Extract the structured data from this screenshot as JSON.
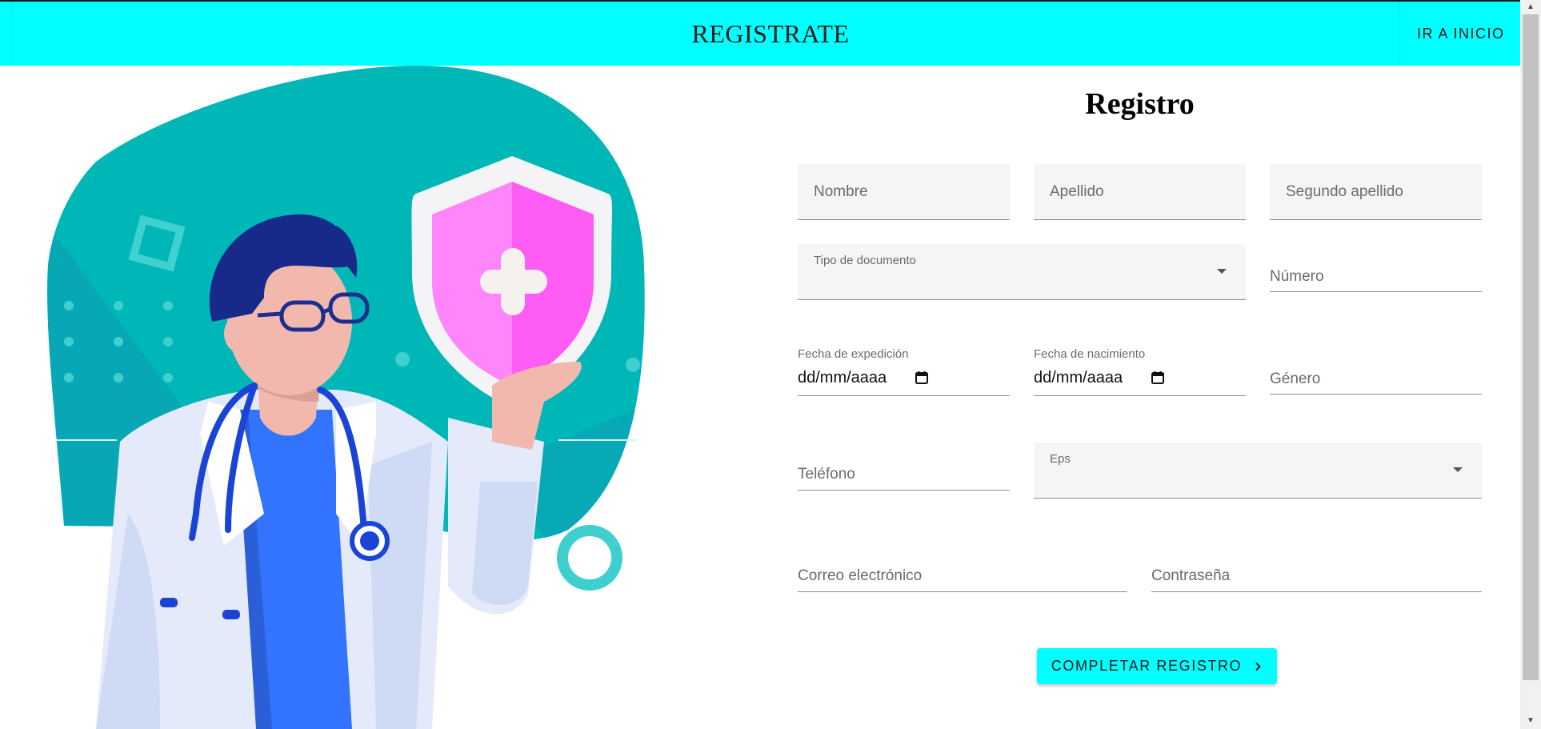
{
  "header": {
    "title": "REGISTRATE",
    "home_link": "IR A INICIO",
    "background": "#00ffff"
  },
  "form": {
    "title": "Registro",
    "fields": {
      "nombre": "Nombre",
      "apellido": "Apellido",
      "segundo_apellido": "Segundo apellido",
      "tipo_documento": "Tipo de documento",
      "numero": "Número",
      "fecha_expedicion_label": "Fecha de expedición",
      "fecha_expedicion_value": "dd/mm/aaaa",
      "fecha_nacimiento_label": "Fecha de nacimiento",
      "fecha_nacimiento_value": "dd/mm/aaaa",
      "genero": "Género",
      "telefono": "Teléfono",
      "eps": "Eps",
      "correo": "Correo electrónico",
      "contrasena": "Contraseña"
    },
    "submit_label": "COMPLETAR REGISTRO"
  },
  "illustration": {
    "subject": "doctor-with-shield",
    "colors": {
      "blob": "#00b8b8",
      "shield": "#ff73f8",
      "coat": "#e4eaf9",
      "shirt": "#3374ff",
      "hair": "#172a8a"
    }
  }
}
